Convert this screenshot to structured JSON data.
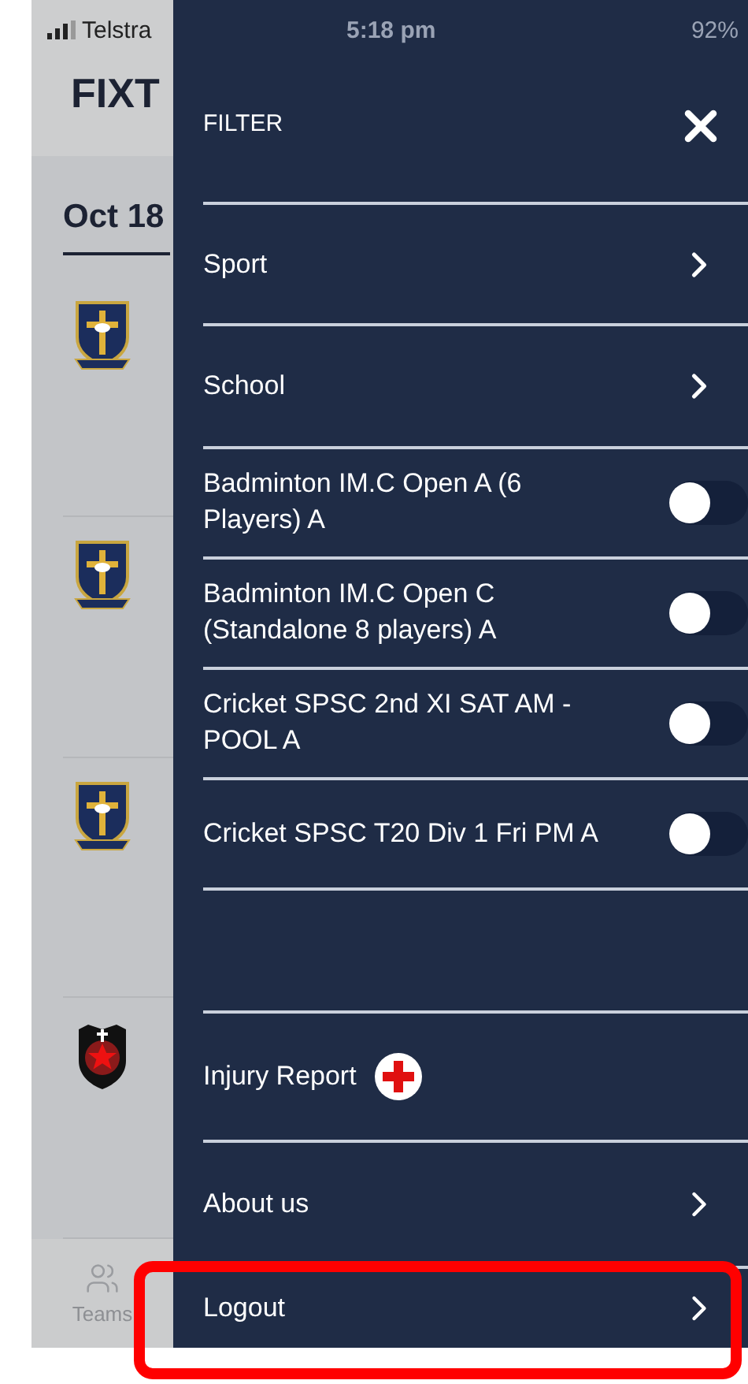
{
  "status_bar": {
    "carrier": "Telstra",
    "time": "5:18 pm",
    "battery": "92%"
  },
  "background": {
    "title": "FIXT",
    "date": "Oct 18",
    "fixtures": [
      {
        "kind": "cross"
      },
      {
        "kind": "cross"
      },
      {
        "kind": "cross"
      },
      {
        "kind": "star"
      }
    ],
    "tab_bar": [
      {
        "label": "Teams"
      }
    ]
  },
  "drawer": {
    "title": "FILTER",
    "nav": [
      {
        "label": "Sport"
      },
      {
        "label": "School"
      }
    ],
    "toggles": [
      {
        "label": "Badminton IM.C Open A (6 Players) A",
        "on": false
      },
      {
        "label": "Badminton IM.C Open C (Standalone 8 players) A",
        "on": false
      },
      {
        "label": "Cricket SPSC 2nd XI SAT AM - POOL A",
        "on": false
      },
      {
        "label": "Cricket SPSC T20 Div 1 Fri PM A",
        "on": false
      }
    ],
    "menu": [
      {
        "label": "Injury Report",
        "kind": "badge"
      },
      {
        "label": "About us",
        "kind": "chevron"
      },
      {
        "label": "Logout",
        "kind": "chevron"
      }
    ]
  }
}
